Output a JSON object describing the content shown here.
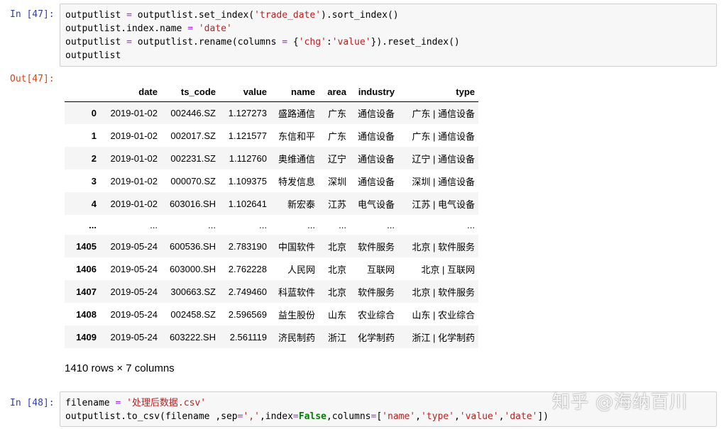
{
  "cell47": {
    "in_prompt": "In [47]:",
    "out_prompt": "Out[47]:",
    "code": [
      "outputlist = outputlist.set_index('trade_date').sort_index()",
      "outputlist.index.name = 'date'",
      "outputlist = outputlist.rename(columns = {'chg':'value'}).reset_index()",
      "outputlist"
    ]
  },
  "dataframe": {
    "columns": [
      "",
      "date",
      "ts_code",
      "value",
      "name",
      "area",
      "industry",
      "type"
    ],
    "rows": [
      [
        "0",
        "2019-01-02",
        "002446.SZ",
        "1.127273",
        "盛路通信",
        "广东",
        "通信设备",
        "广东 | 通信设备"
      ],
      [
        "1",
        "2019-01-02",
        "002017.SZ",
        "1.121577",
        "东信和平",
        "广东",
        "通信设备",
        "广东 | 通信设备"
      ],
      [
        "2",
        "2019-01-02",
        "002231.SZ",
        "1.112760",
        "奥维通信",
        "辽宁",
        "通信设备",
        "辽宁 | 通信设备"
      ],
      [
        "3",
        "2019-01-02",
        "000070.SZ",
        "1.109375",
        "特发信息",
        "深圳",
        "通信设备",
        "深圳 | 通信设备"
      ],
      [
        "4",
        "2019-01-02",
        "603016.SH",
        "1.102641",
        "新宏泰",
        "江苏",
        "电气设备",
        "江苏 | 电气设备"
      ],
      [
        "...",
        "...",
        "...",
        "...",
        "...",
        "...",
        "...",
        "..."
      ],
      [
        "1405",
        "2019-05-24",
        "600536.SH",
        "2.783190",
        "中国软件",
        "北京",
        "软件服务",
        "北京 | 软件服务"
      ],
      [
        "1406",
        "2019-05-24",
        "603000.SH",
        "2.762228",
        "人民网",
        "北京",
        "互联网",
        "北京 | 互联网"
      ],
      [
        "1407",
        "2019-05-24",
        "300663.SZ",
        "2.749460",
        "科蓝软件",
        "北京",
        "软件服务",
        "北京 | 软件服务"
      ],
      [
        "1408",
        "2019-05-24",
        "002458.SZ",
        "2.596569",
        "益生股份",
        "山东",
        "农业综合",
        "山东 | 农业综合"
      ],
      [
        "1409",
        "2019-05-24",
        "603222.SH",
        "2.561119",
        "济民制药",
        "浙江",
        "化学制药",
        "浙江 | 化学制药"
      ]
    ],
    "shape": "1410 rows × 7 columns"
  },
  "cell48": {
    "in_prompt": "In [48]:",
    "code": [
      "filename = '处理后数据.csv'",
      "outputlist.to_csv(filename ,sep=',',index=False,columns=['name','type','value','date'])"
    ]
  },
  "watermark": "知乎 @海纳百川"
}
